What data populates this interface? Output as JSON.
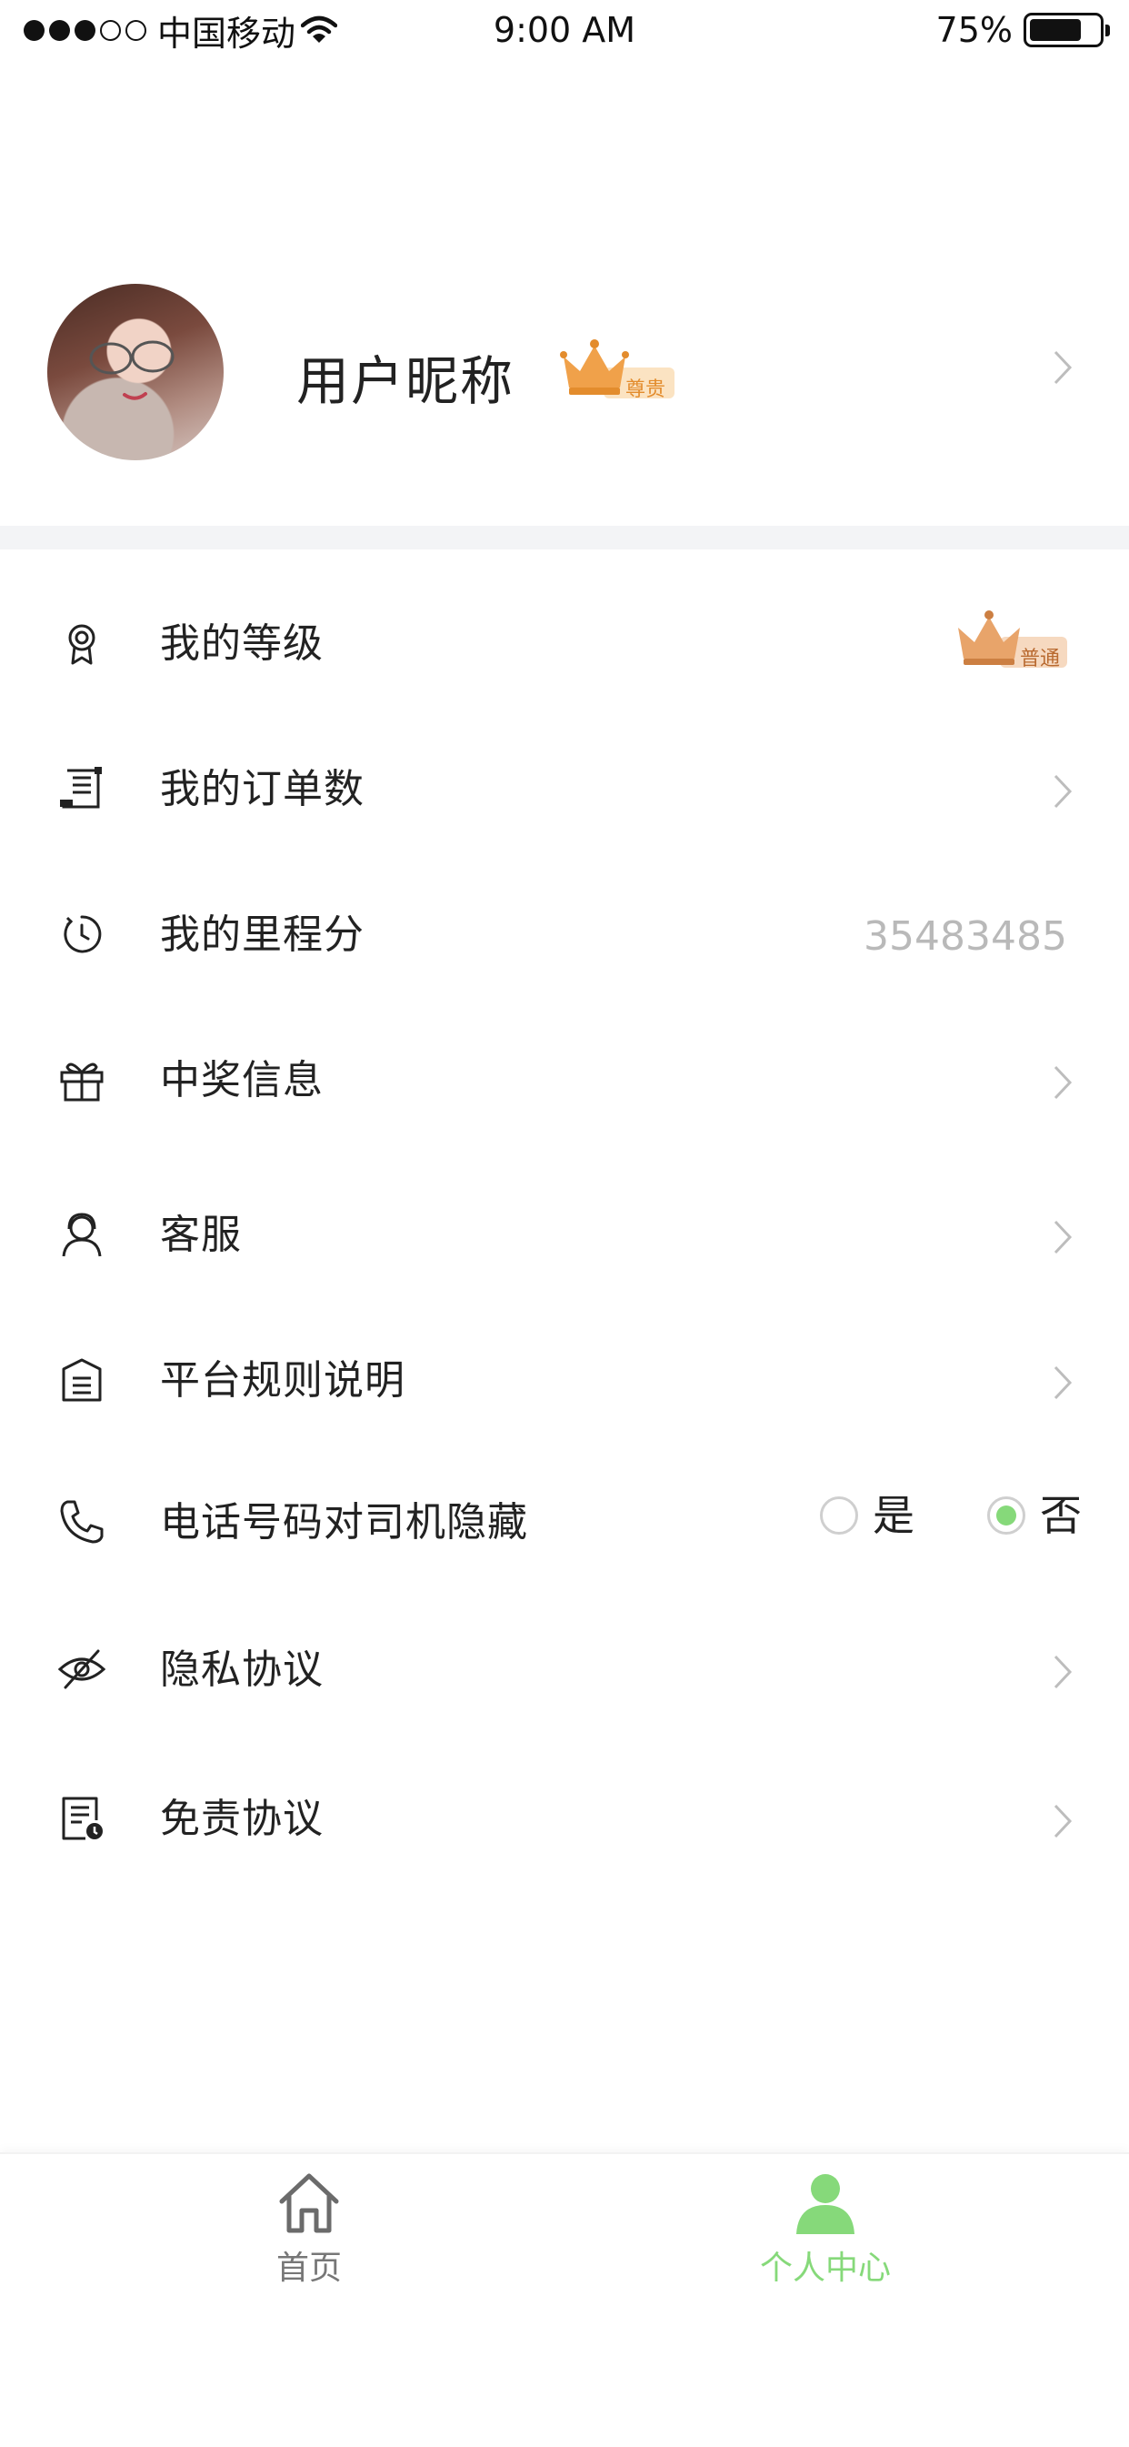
{
  "status_bar": {
    "carrier": "中国移动",
    "time": "9:00 AM",
    "battery": "75%",
    "battery_level": 0.75
  },
  "profile": {
    "nickname": "用户昵称",
    "badge": "尊贵"
  },
  "menu": {
    "items": [
      {
        "label": "我的等级",
        "icon": "award-icon",
        "badge": "普通"
      },
      {
        "label": "我的订单数",
        "icon": "receipt-icon"
      },
      {
        "label": "我的里程分",
        "icon": "timer-icon",
        "value": "35483485"
      },
      {
        "label": "中奖信息",
        "icon": "gift-icon"
      },
      {
        "label": "客服",
        "icon": "user-headset-icon"
      },
      {
        "label": "平台规则说明",
        "icon": "rules-document-icon"
      },
      {
        "label": "电话号码对司机隐藏",
        "icon": "phone-icon",
        "options": [
          "是",
          "否"
        ],
        "selected": "否"
      },
      {
        "label": "隐私协议",
        "icon": "eye-off-icon"
      },
      {
        "label": "免责协议",
        "icon": "document-clock-icon"
      }
    ]
  },
  "tab_bar": {
    "tabs": [
      {
        "label": "首页",
        "icon": "home-icon",
        "active": false
      },
      {
        "label": "个人中心",
        "icon": "person-icon",
        "active": true
      }
    ]
  },
  "colors": {
    "accent": "#86d97a",
    "crown_orange": "#f0a14a",
    "muted_text": "#b9b9b9",
    "divider": "#f3f4f6"
  }
}
